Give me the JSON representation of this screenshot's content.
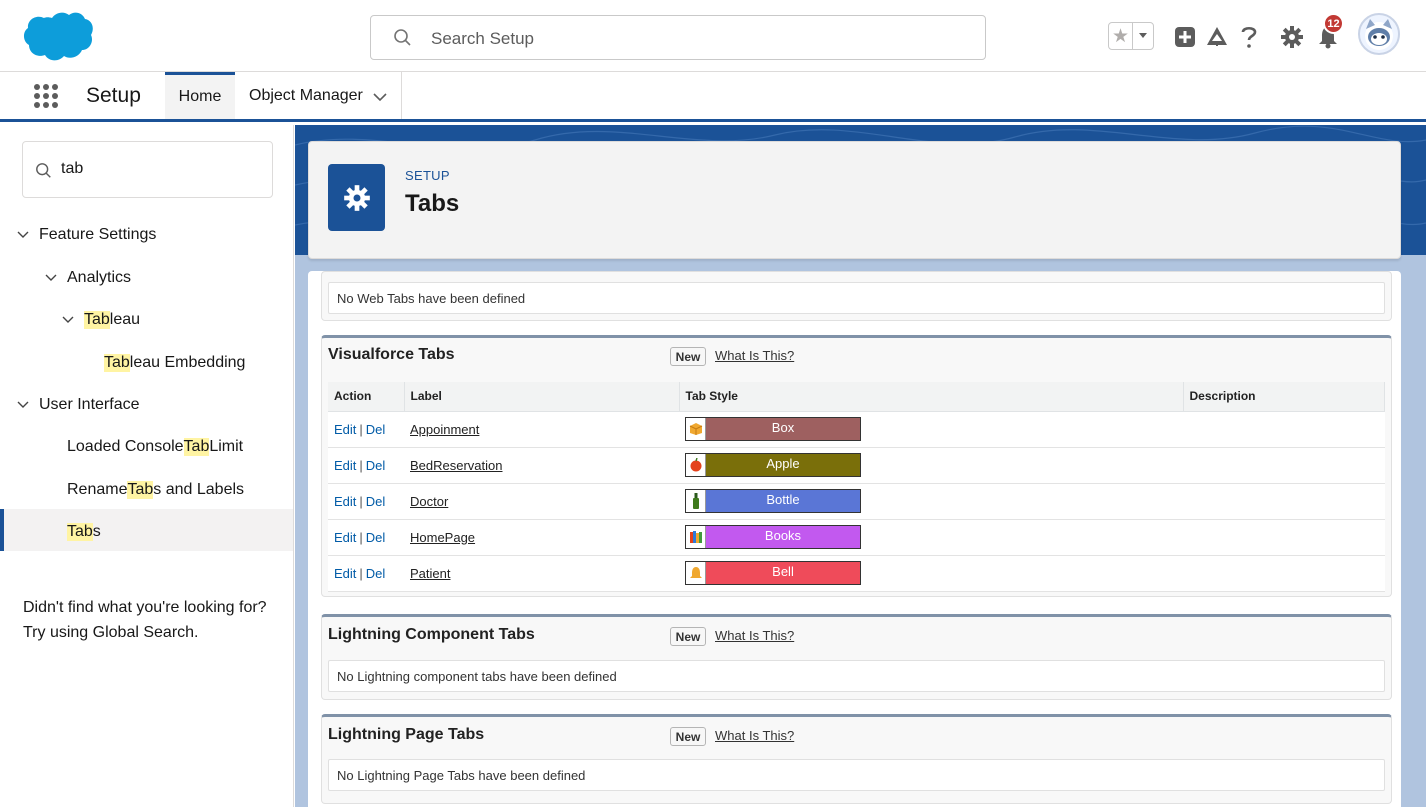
{
  "header": {
    "search_placeholder": "Search Setup",
    "notification_count": "12"
  },
  "context": {
    "app_name": "Setup",
    "tabs": [
      {
        "label": "Home"
      },
      {
        "label": "Object Manager"
      }
    ]
  },
  "sidebar": {
    "quickfind_value": "tab",
    "tree": [
      {
        "pre": "",
        "hl": "",
        "post": "Feature Settings"
      },
      {
        "pre": "",
        "hl": "",
        "post": "Analytics"
      },
      {
        "pre": "",
        "hl": "Tab",
        "post": "leau"
      },
      {
        "pre": "",
        "hl": "Tab",
        "post": "leau Embedding"
      },
      {
        "pre": "",
        "hl": "",
        "post": "User Interface"
      },
      {
        "pre": "Loaded Console ",
        "hl": "Tab",
        "post": " Limit"
      },
      {
        "pre": "Rename ",
        "hl": "Tab",
        "post": "s and Labels"
      },
      {
        "pre": "",
        "hl": "Tab",
        "post": "s"
      }
    ],
    "help_line1": "Didn't find what you're looking for?",
    "help_line2": "Try using Global Search."
  },
  "page": {
    "eyebrow": "SETUP",
    "title": "Tabs"
  },
  "web_tabs": {
    "empty_message": "No Web Tabs have been defined"
  },
  "visualforce": {
    "title": "Visualforce Tabs",
    "new_label": "New",
    "what_label": "What Is This?",
    "columns": [
      "Action",
      "Label",
      "Tab Style",
      "Description"
    ],
    "edit_label": "Edit",
    "del_label": "Del",
    "rows": [
      {
        "label": "Appoinment",
        "style": "Box",
        "color": "#9e6060",
        "icon": "box-icon",
        "description": ""
      },
      {
        "label": "BedReservation",
        "style": "Apple",
        "color": "#7a6f0a",
        "icon": "apple-icon",
        "description": ""
      },
      {
        "label": "Doctor",
        "style": "Bottle",
        "color": "#5a76d6",
        "icon": "bottle-icon",
        "description": ""
      },
      {
        "label": "HomePage",
        "style": "Books",
        "color": "#c259ef",
        "icon": "books-icon",
        "description": ""
      },
      {
        "label": "Patient",
        "style": "Bell",
        "color": "#ef4b5a",
        "icon": "bell-icon",
        "description": ""
      }
    ]
  },
  "lightning_component": {
    "title": "Lightning Component Tabs",
    "new_label": "New",
    "what_label": "What Is This?",
    "empty_message": "No Lightning component tabs have been defined"
  },
  "lightning_page": {
    "title": "Lightning Page Tabs",
    "new_label": "New",
    "what_label": "What Is This?",
    "empty_message": "No Lightning Page Tabs have been defined"
  },
  "colors": {
    "brand": "#1b5297",
    "link": "#015ba7",
    "highlight": "#fff4a3",
    "notification": "#c23934",
    "cloud": "#0d9dda"
  }
}
